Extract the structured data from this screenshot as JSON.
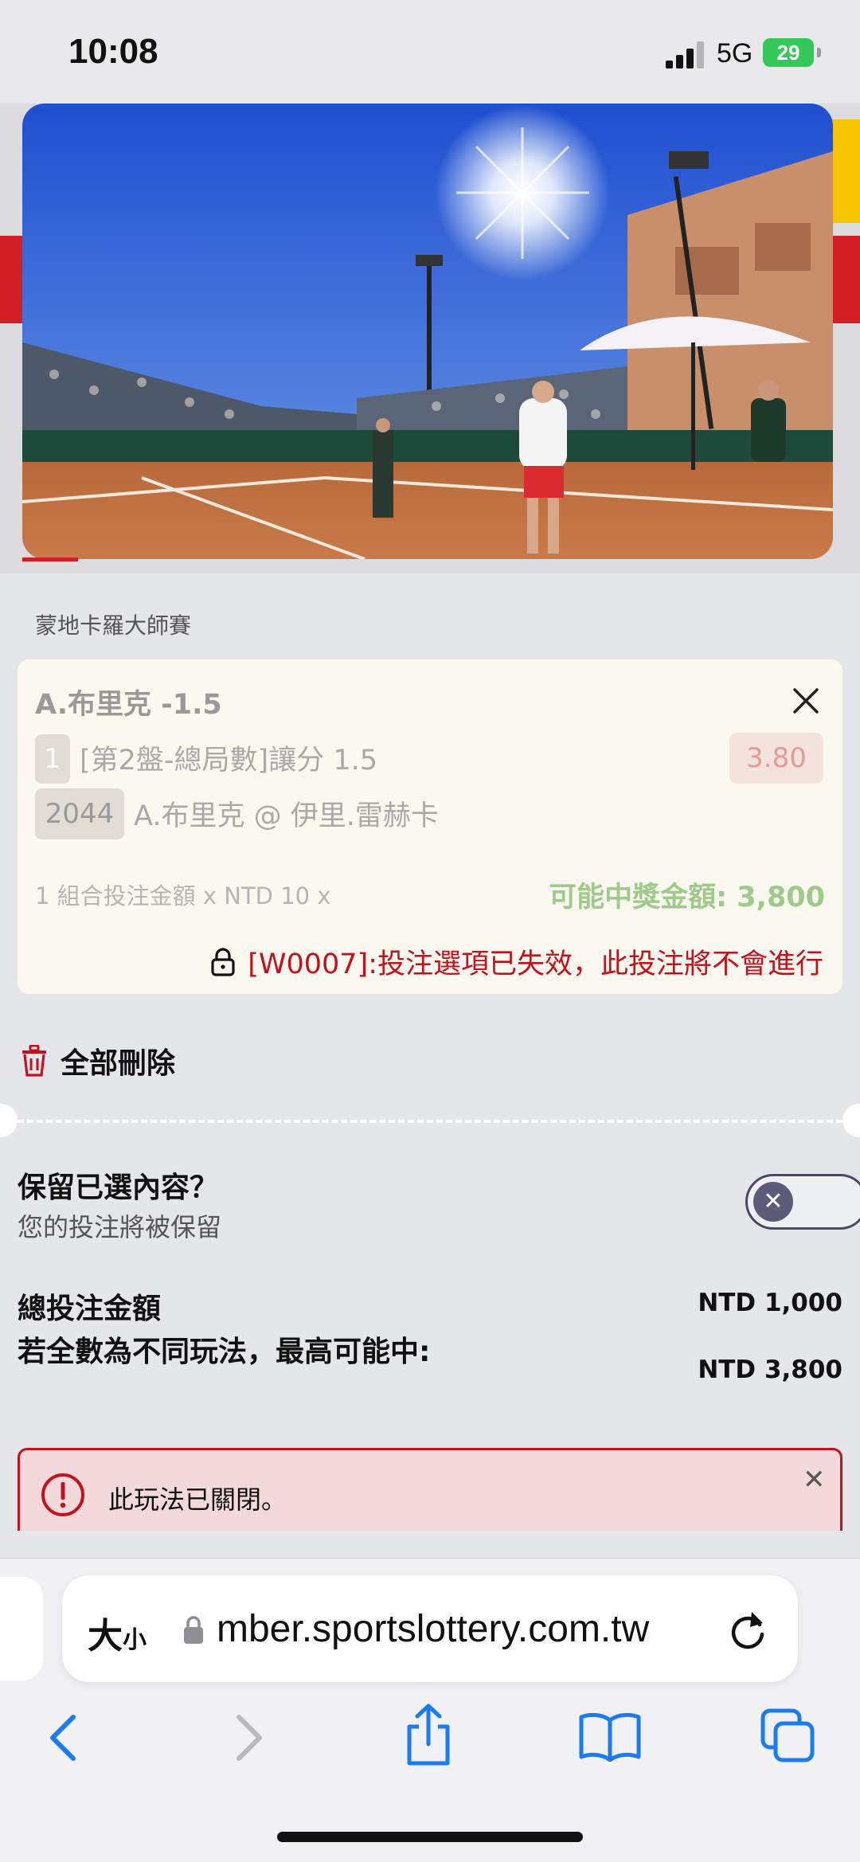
{
  "status_bar": {
    "time": "10:08",
    "network": "5G",
    "battery": "29"
  },
  "league": "蒙地卡羅大師賽",
  "bet": {
    "selection": "A.布里克 -1.5",
    "leg_number": "1",
    "market": "[第2盤-總局數]讓分 1.5",
    "odds": "3.80",
    "event_code": "2044",
    "match": "A.布里克 @ 伊里.雷赫卡",
    "combo": "1 組合投注金額 x NTD 10 x",
    "possible_win": "可能中獎金額: 3,800",
    "warning": "[W0007]:投注選項已失效，此投注將不會進行"
  },
  "delete_all_label": "全部刪除",
  "keep": {
    "title": "保留已選內容？",
    "subtitle": "您的投注將被保留"
  },
  "totals": {
    "total_label": "總投注金額",
    "total_value": "NTD 1,000",
    "max_label": "若全數為不同玩法，最高可能中:",
    "max_value": "NTD 3,800"
  },
  "alert": {
    "message": "此玩法已關閉。"
  },
  "browser": {
    "text_size_label": "大",
    "text_size_small": "小",
    "url": "mber.sportslottery.com.tw"
  },
  "colors": {
    "accent": "#c3121b",
    "win": "#9ecb8c",
    "safari_blue": "#1a7cf0"
  }
}
